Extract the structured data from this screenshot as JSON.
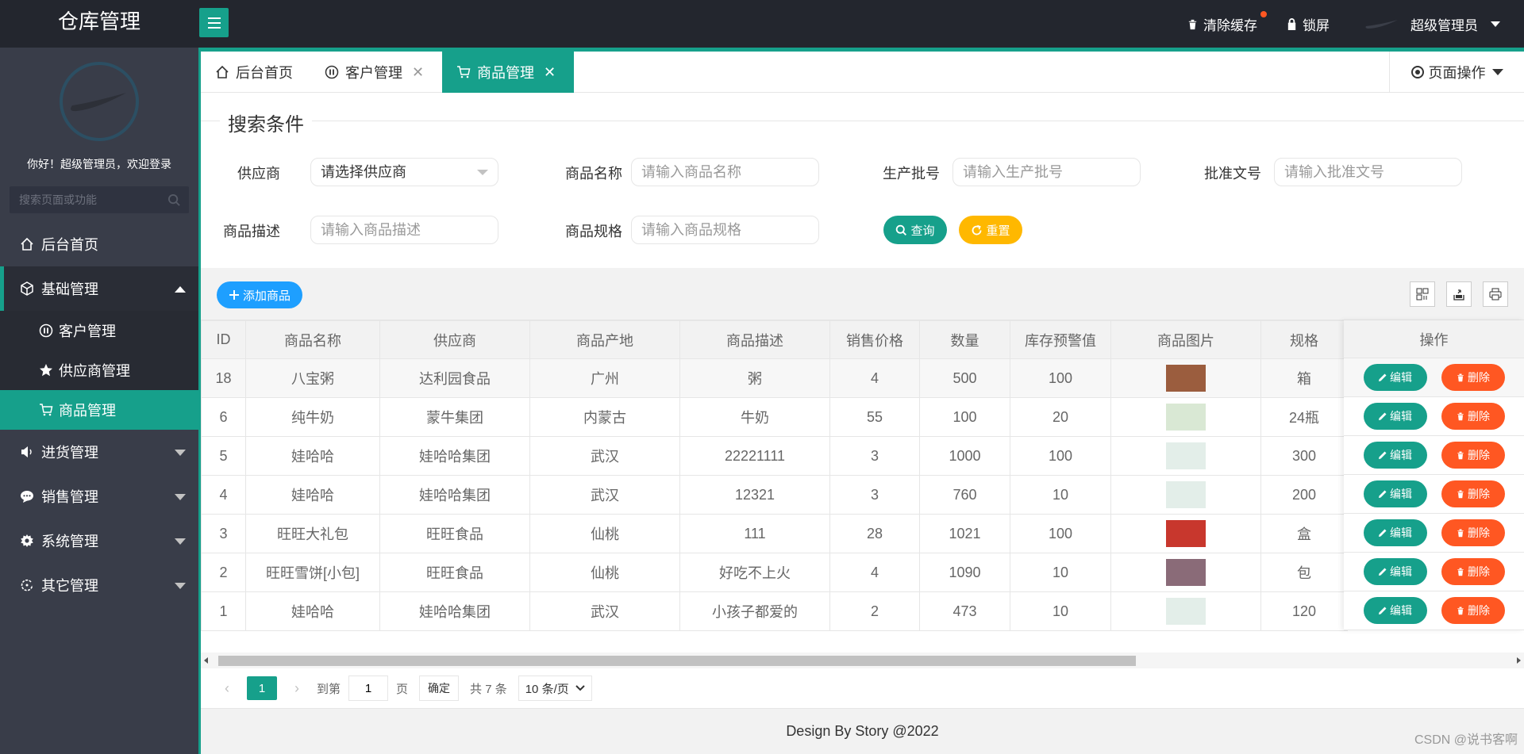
{
  "header": {
    "title": "仓库管理",
    "clear_cache": "清除缓存",
    "lock": "锁屏",
    "user": "超级管理员"
  },
  "sidebar": {
    "welcome": "你好！超级管理员，欢迎登录",
    "search_placeholder": "搜索页面或功能",
    "items": [
      {
        "label": "后台首页",
        "icon": "home-icon"
      },
      {
        "label": "基础管理",
        "icon": "cube-icon",
        "open": true,
        "children": [
          {
            "label": "客户管理",
            "icon": "pause-circle-icon"
          },
          {
            "label": "供应商管理",
            "icon": "star-icon"
          },
          {
            "label": "商品管理",
            "icon": "cart-icon",
            "active": true
          }
        ]
      },
      {
        "label": "进货管理",
        "icon": "speaker-icon"
      },
      {
        "label": "销售管理",
        "icon": "chat-icon"
      },
      {
        "label": "系统管理",
        "icon": "gear-icon"
      },
      {
        "label": "其它管理",
        "icon": "loop-icon"
      }
    ]
  },
  "tabs": [
    {
      "label": "后台首页",
      "icon": "home-icon",
      "closable": false
    },
    {
      "label": "客户管理",
      "icon": "pause-circle-icon",
      "closable": true
    },
    {
      "label": "商品管理",
      "icon": "cart-icon",
      "closable": true,
      "active": true
    }
  ],
  "page_ops": "页面操作",
  "search": {
    "legend": "搜索条件",
    "supplier_label": "供应商",
    "supplier_value": "请选择供应商",
    "name_label": "商品名称",
    "name_placeholder": "请输入商品名称",
    "batch_label": "生产批号",
    "batch_placeholder": "请输入生产批号",
    "approval_label": "批准文号",
    "approval_placeholder": "请输入批准文号",
    "desc_label": "商品描述",
    "desc_placeholder": "请输入商品描述",
    "spec_label": "商品规格",
    "spec_placeholder": "请输入商品规格",
    "query_btn": "查询",
    "reset_btn": "重置"
  },
  "toolbar": {
    "add_btn": "添加商品"
  },
  "table": {
    "headers": [
      "ID",
      "商品名称",
      "供应商",
      "商品产地",
      "商品描述",
      "销售价格",
      "数量",
      "库存预警值",
      "商品图片",
      "规格"
    ],
    "action_header": "操作",
    "edit_label": "编辑",
    "delete_label": "删除",
    "rows": [
      {
        "id": "18",
        "name": "八宝粥",
        "supplier": "达利园食品",
        "origin": "广州",
        "desc": "粥",
        "price": "4",
        "qty": "500",
        "warn": "100",
        "img": "#9b5d3e",
        "spec": "箱"
      },
      {
        "id": "6",
        "name": "纯牛奶",
        "supplier": "蒙牛集团",
        "origin": "内蒙古",
        "desc": "牛奶",
        "price": "55",
        "qty": "100",
        "warn": "20",
        "img": "#d9e8d4",
        "spec": "24瓶"
      },
      {
        "id": "5",
        "name": "娃哈哈",
        "supplier": "娃哈哈集团",
        "origin": "武汉",
        "desc": "22221111",
        "price": "3",
        "qty": "1000",
        "warn": "100",
        "img": "#e3eee9",
        "spec": "300"
      },
      {
        "id": "4",
        "name": "娃哈哈",
        "supplier": "娃哈哈集团",
        "origin": "武汉",
        "desc": "12321",
        "price": "3",
        "qty": "760",
        "warn": "10",
        "img": "#e3eee9",
        "spec": "200"
      },
      {
        "id": "3",
        "name": "旺旺大礼包",
        "supplier": "旺旺食品",
        "origin": "仙桃",
        "desc": "111",
        "price": "28",
        "qty": "1021",
        "warn": "100",
        "img": "#c8372d",
        "spec": "盒"
      },
      {
        "id": "2",
        "name": "旺旺雪饼[小包]",
        "supplier": "旺旺食品",
        "origin": "仙桃",
        "desc": "好吃不上火",
        "price": "4",
        "qty": "1090",
        "warn": "10",
        "img": "#8a6b78",
        "spec": "包"
      },
      {
        "id": "1",
        "name": "娃哈哈",
        "supplier": "娃哈哈集团",
        "origin": "武汉",
        "desc": "小孩子都爱的",
        "price": "2",
        "qty": "473",
        "warn": "10",
        "img": "#e3eee9",
        "spec": "120"
      }
    ]
  },
  "pager": {
    "current": "1",
    "goto_label": "到第",
    "goto_value": "1",
    "page_unit": "页",
    "confirm": "确定",
    "total": "共 7 条",
    "page_size": "10 条/页"
  },
  "footer": "Design By Story @2022",
  "watermark": "CSDN @说书客啊",
  "colors": {
    "accent": "#16a08b",
    "header": "#23262e",
    "sidebar": "#393d49",
    "blue": "#1e9fff",
    "warm": "#ffb800",
    "danger": "#ff5722"
  }
}
